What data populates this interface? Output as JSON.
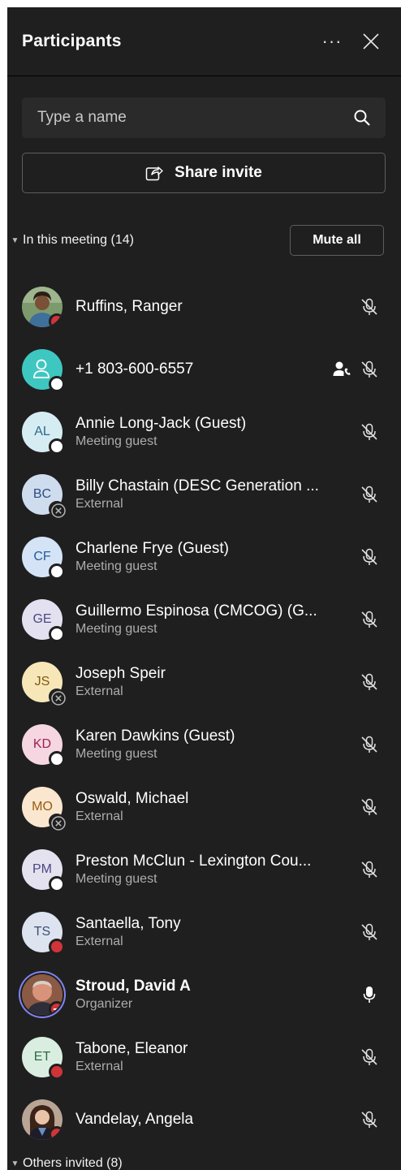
{
  "header": {
    "title": "Participants",
    "more_label": "···"
  },
  "search": {
    "placeholder": "Type a name"
  },
  "share": {
    "label": "Share invite"
  },
  "in_meeting": {
    "label": "In this meeting (14)",
    "mute_all": "Mute all"
  },
  "participants": [
    {
      "name": "Ruffins, Ranger",
      "sub": "",
      "initials": "",
      "avatar": "photo-woman",
      "avatar_bg": "#6b8a5e",
      "avatar_fg": "#ffffff",
      "status": "busy",
      "mic": "muted"
    },
    {
      "name": "+1 803-600-6557",
      "sub": "",
      "initials": "",
      "avatar": "phone-user",
      "avatar_bg": "#3ec7c0",
      "avatar_fg": "#ffffff",
      "status": "away",
      "mic": "muted",
      "phone": true
    },
    {
      "name": "Annie Long-Jack (Guest)",
      "sub": "Meeting guest",
      "initials": "AL",
      "avatar": "initials",
      "avatar_bg": "#d6ecf3",
      "avatar_fg": "#2a6b8a",
      "status": "away",
      "mic": "muted"
    },
    {
      "name": "Billy Chastain (DESC Generation ...",
      "sub": "External",
      "initials": "BC",
      "avatar": "initials",
      "avatar_bg": "#cfdcee",
      "avatar_fg": "#2c4c82",
      "status": "offline",
      "mic": "muted"
    },
    {
      "name": "Charlene Frye (Guest)",
      "sub": "Meeting guest",
      "initials": "CF",
      "avatar": "initials",
      "avatar_bg": "#d4e3f6",
      "avatar_fg": "#275b9a",
      "status": "away",
      "mic": "muted"
    },
    {
      "name": "Guillermo Espinosa (CMCOG) (G...",
      "sub": "Meeting guest",
      "initials": "GE",
      "avatar": "initials",
      "avatar_bg": "#e3e1f0",
      "avatar_fg": "#4b4780",
      "status": "away",
      "mic": "muted"
    },
    {
      "name": "Joseph Speir",
      "sub": "External",
      "initials": "JS",
      "avatar": "initials",
      "avatar_bg": "#f7e6b8",
      "avatar_fg": "#7a5b10",
      "status": "offline",
      "mic": "muted"
    },
    {
      "name": "Karen Dawkins (Guest)",
      "sub": "Meeting guest",
      "initials": "KD",
      "avatar": "initials",
      "avatar_bg": "#f6d6e1",
      "avatar_fg": "#9a2350",
      "status": "away",
      "mic": "muted"
    },
    {
      "name": "Oswald, Michael",
      "sub": "External",
      "initials": "MO",
      "avatar": "initials",
      "avatar_bg": "#fbe7cf",
      "avatar_fg": "#9a5a12",
      "status": "offline",
      "mic": "muted"
    },
    {
      "name": "Preston McClun - Lexington Cou...",
      "sub": "Meeting guest",
      "initials": "PM",
      "avatar": "initials",
      "avatar_bg": "#e4e2ef",
      "avatar_fg": "#4a4582",
      "status": "away",
      "mic": "muted"
    },
    {
      "name": "Santaella, Tony",
      "sub": "External",
      "initials": "TS",
      "avatar": "initials",
      "avatar_bg": "#dde3ef",
      "avatar_fg": "#3a4f77",
      "status": "busy",
      "mic": "muted"
    },
    {
      "name": "Stroud, David A",
      "sub": "Organizer",
      "initials": "",
      "avatar": "photo-man",
      "avatar_bg": "#b86b52",
      "avatar_fg": "#ffffff",
      "status": "dnd",
      "mic": "on",
      "bold": true,
      "ring": true
    },
    {
      "name": "Tabone, Eleanor",
      "sub": "External",
      "initials": "ET",
      "avatar": "initials",
      "avatar_bg": "#d9eee0",
      "avatar_fg": "#2d6b45",
      "status": "busy",
      "mic": "muted"
    },
    {
      "name": "Vandelay, Angela",
      "sub": "",
      "initials": "",
      "avatar": "photo-woman2",
      "avatar_bg": "#5a4438",
      "avatar_fg": "#ffffff",
      "status": "busy",
      "mic": "muted"
    }
  ],
  "others_invited": {
    "label": "Others invited (8)"
  },
  "colors": {
    "panel_bg": "#1f1f1f",
    "busy": "#d13438",
    "organizer_ring": "#7f85f5",
    "muted_text": "#adadad"
  }
}
